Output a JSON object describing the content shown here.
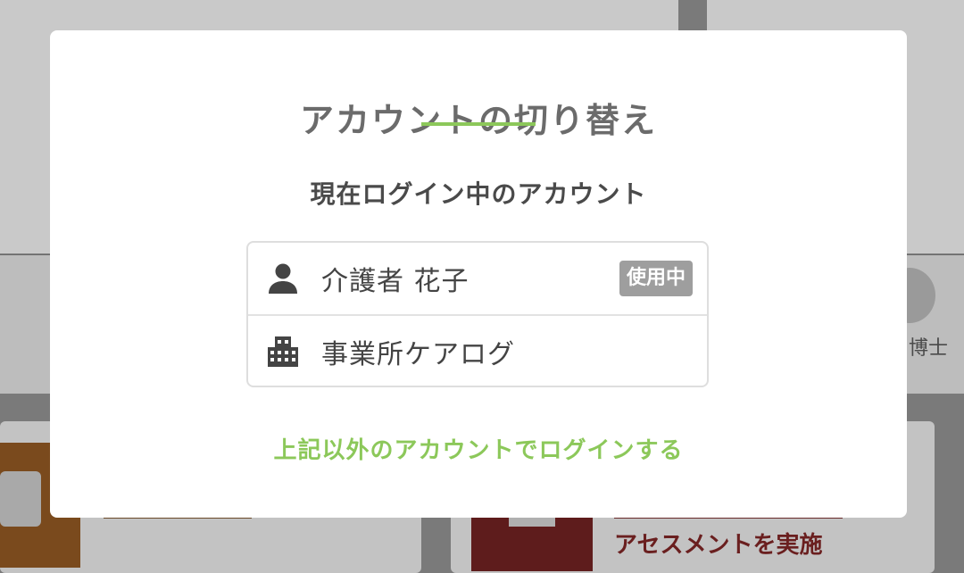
{
  "background": {
    "profile_name_partial": "博士",
    "tile_text_partial": "アセスメントを実施"
  },
  "modal": {
    "title": "アカウントの切り替え",
    "current_label": "現在ログイン中のアカウント",
    "accounts": [
      {
        "name": "介護者 花子",
        "icon": "person-icon",
        "badge": "使用中"
      },
      {
        "name": "事業所ケアログ",
        "icon": "building-icon"
      }
    ],
    "other_login_link": "上記以外のアカウントでログインする",
    "accent_color": "#8cc85a"
  }
}
